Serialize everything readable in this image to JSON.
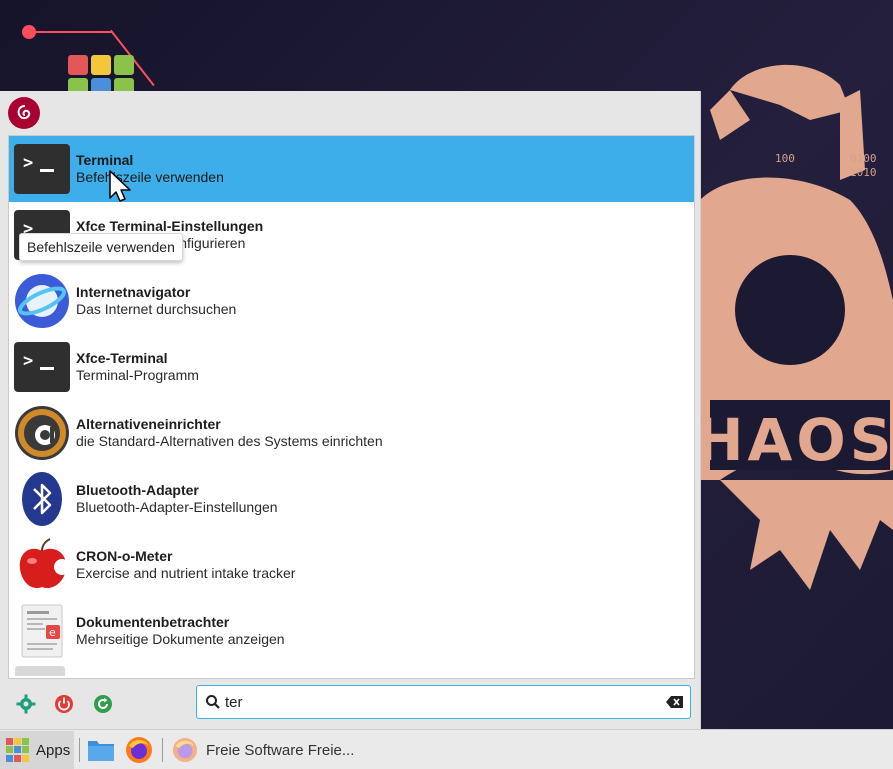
{
  "colors": {
    "accent": "#3daee9",
    "debian": "#a80030",
    "panel": "#e6e6e6"
  },
  "desktop": {
    "wallpaper_text": "HAOS M"
  },
  "menu": {
    "logo_icon": "debian-swirl-icon",
    "items": [
      {
        "title": "Terminal",
        "subtitle": "Befehlszeile verwenden",
        "icon": "terminal-icon",
        "selected": true
      },
      {
        "title": "Xfce Terminal-Einstellungen",
        "subtitle": "Xfce Terminal konfigurieren",
        "icon": "terminal-settings-icon",
        "selected": false
      },
      {
        "title": "Internetnavigator",
        "subtitle": "Das Internet durchsuchen",
        "icon": "web-browser-icon",
        "selected": false
      },
      {
        "title": "Xfce-Terminal",
        "subtitle": "Terminal-Programm",
        "icon": "terminal-icon",
        "selected": false
      },
      {
        "title": "Alternativeneinrichter",
        "subtitle": "die Standard-Alternativen des Systems einrichten",
        "icon": "alternatives-icon",
        "selected": false
      },
      {
        "title": "Bluetooth-Adapter",
        "subtitle": "Bluetooth-Adapter-Einstellungen",
        "icon": "bluetooth-icon",
        "selected": false
      },
      {
        "title": "CRON-o-Meter",
        "subtitle": "Exercise and nutrient intake tracker",
        "icon": "apple-icon",
        "selected": false
      },
      {
        "title": "Dokumentenbetrachter",
        "subtitle": "Mehrseitige Dokumente anzeigen",
        "icon": "document-viewer-icon",
        "selected": false
      }
    ],
    "tooltip": "Befehlszeile verwenden"
  },
  "actions": [
    {
      "name": "settings-button",
      "icon": "settings-gear-icon"
    },
    {
      "name": "logout-button",
      "icon": "power-icon"
    },
    {
      "name": "switch-user-button",
      "icon": "refresh-icon"
    }
  ],
  "search": {
    "value": "ter",
    "icon": "search-icon",
    "clear_icon": "clear-input-icon"
  },
  "taskbar": {
    "apps_label": "Apps",
    "task_label": "Freie Software Freie..."
  }
}
